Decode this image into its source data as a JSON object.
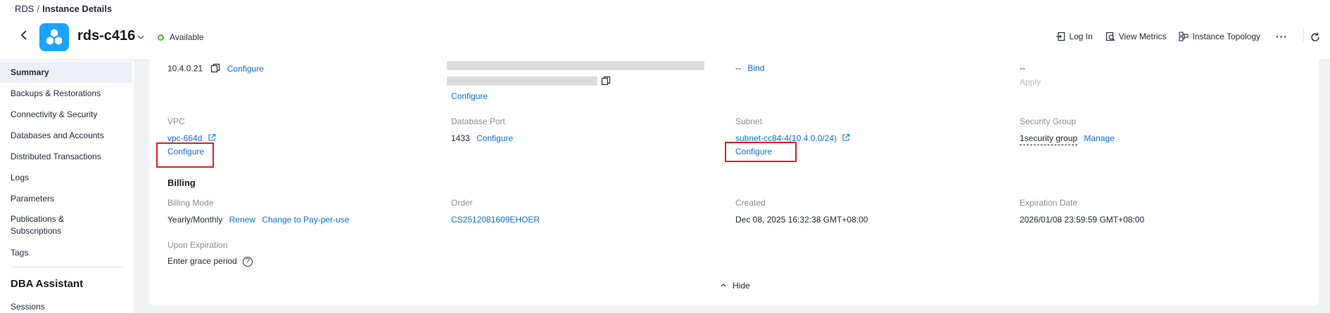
{
  "breadcrumb": {
    "root": "RDS",
    "separator": "/",
    "current": "Instance Details"
  },
  "header": {
    "instance_name": "rds-c416",
    "status": "Available",
    "actions": {
      "login": "Log In",
      "view_metrics": "View Metrics",
      "topology": "Instance Topology",
      "more": "···"
    }
  },
  "sidebar": {
    "items": [
      "Summary",
      "Backups & Restorations",
      "Connectivity & Security",
      "Databases and Accounts",
      "Distributed Transactions",
      "Logs",
      "Parameters",
      "Publications & Subscriptions",
      "Tags"
    ],
    "heading": "DBA Assistant",
    "sub_items": [
      "Sessions"
    ]
  },
  "details": {
    "row0": {
      "ip": "10.4.0.21",
      "configure": "Configure",
      "col2_configure": "Configure",
      "col3_value": "--",
      "col3_bind": "Bind",
      "col4_value": "--",
      "col4_apply": "Apply"
    },
    "vpc": {
      "label": "VPC",
      "value": "vpc-664d",
      "configure": "Configure"
    },
    "port": {
      "label": "Database Port",
      "value": "1433",
      "configure": "Configure"
    },
    "subnet": {
      "label": "Subnet",
      "value": "subnet-cc84-4(10.4.0.0/24)",
      "configure": "Configure"
    },
    "security_group": {
      "label": "Security Group",
      "value": "1security group",
      "manage": "Manage"
    }
  },
  "billing": {
    "title": "Billing",
    "mode": {
      "label": "Billing Mode",
      "value": "Yearly/Monthly",
      "renew": "Renew",
      "change": "Change to Pay-per-use"
    },
    "order": {
      "label": "Order",
      "value": "CS2512081609EHOER"
    },
    "created": {
      "label": "Created",
      "value": "Dec 08, 2025 16:32:38 GMT+08:00"
    },
    "expiration": {
      "label": "Expiration Date",
      "value": "2026/01/08 23:59:59 GMT+08:00"
    },
    "upon_expiration": {
      "label": "Upon Expiration",
      "value": "Enter grace period",
      "help": "?"
    }
  },
  "hide": {
    "label": "Hide"
  },
  "colors": {
    "link": "#0f6fd6",
    "status_available": "#50b432",
    "logo": "#1aa3ff",
    "highlight_box": "#e02020"
  },
  "icons": [
    "back-arrow-icon",
    "rds-logo-icon",
    "chevron-down-icon",
    "login-icon",
    "metrics-icon",
    "topology-icon",
    "more-icon",
    "refresh-icon",
    "copy-icon",
    "external-link-icon",
    "help-icon",
    "chevron-up-icon"
  ]
}
